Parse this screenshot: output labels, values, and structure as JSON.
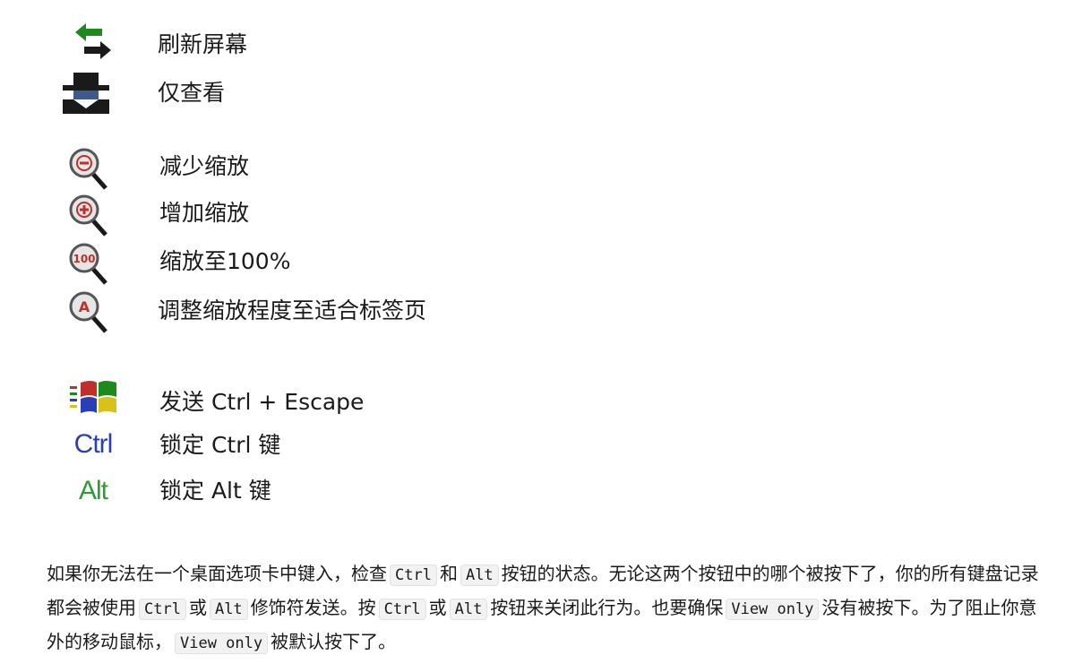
{
  "toolbar_legend": {
    "groups": [
      [
        {
          "icon": "refresh-icon",
          "label": "刷新屏幕"
        },
        {
          "icon": "view-only-icon",
          "label": "仅查看"
        }
      ],
      [
        {
          "icon": "zoom-out-icon",
          "label": "减少缩放"
        },
        {
          "icon": "zoom-in-icon",
          "label": "增加缩放"
        },
        {
          "icon": "zoom-100-icon",
          "label": "缩放至100%"
        },
        {
          "icon": "zoom-fit-icon",
          "label": "调整缩放程度至适合标签页"
        }
      ],
      [
        {
          "icon": "windows-ctrl-esc-icon",
          "label": "发送 Ctrl + Escape"
        },
        {
          "icon": "ctrl-lock-icon",
          "glyph_text": "Ctrl",
          "label": "锁定 Ctrl 键"
        },
        {
          "icon": "alt-lock-icon",
          "glyph_text": "Alt",
          "label": "锁定 Alt 键"
        }
      ]
    ]
  },
  "note": {
    "s1": "如果你无法在一个桌面选项卡中键入，检查",
    "c1": "Ctrl",
    "s2": "和",
    "c2": "Alt",
    "s3": "按钮的状态。无论这两个按钮中的哪个被按下了，你的所有键盘记录都会被使用",
    "c3": "Ctrl",
    "s4": "或",
    "c4": "Alt",
    "s5": "修饰符发送。按",
    "c5": "Ctrl",
    "s6": "或",
    "c6": "Alt",
    "s7": "按钮来关闭此行为。也要确保",
    "c7": "View only",
    "s8": "没有被按下。为了阻止你意外的移动鼠标，",
    "c8": "View only",
    "s9": "被默认按下了。"
  },
  "colors": {
    "green": "#1e8a1e",
    "ctrl_blue": "#2b3fb5",
    "alt_green": "#2f9a3a",
    "zoom_red": "#c0302a"
  }
}
